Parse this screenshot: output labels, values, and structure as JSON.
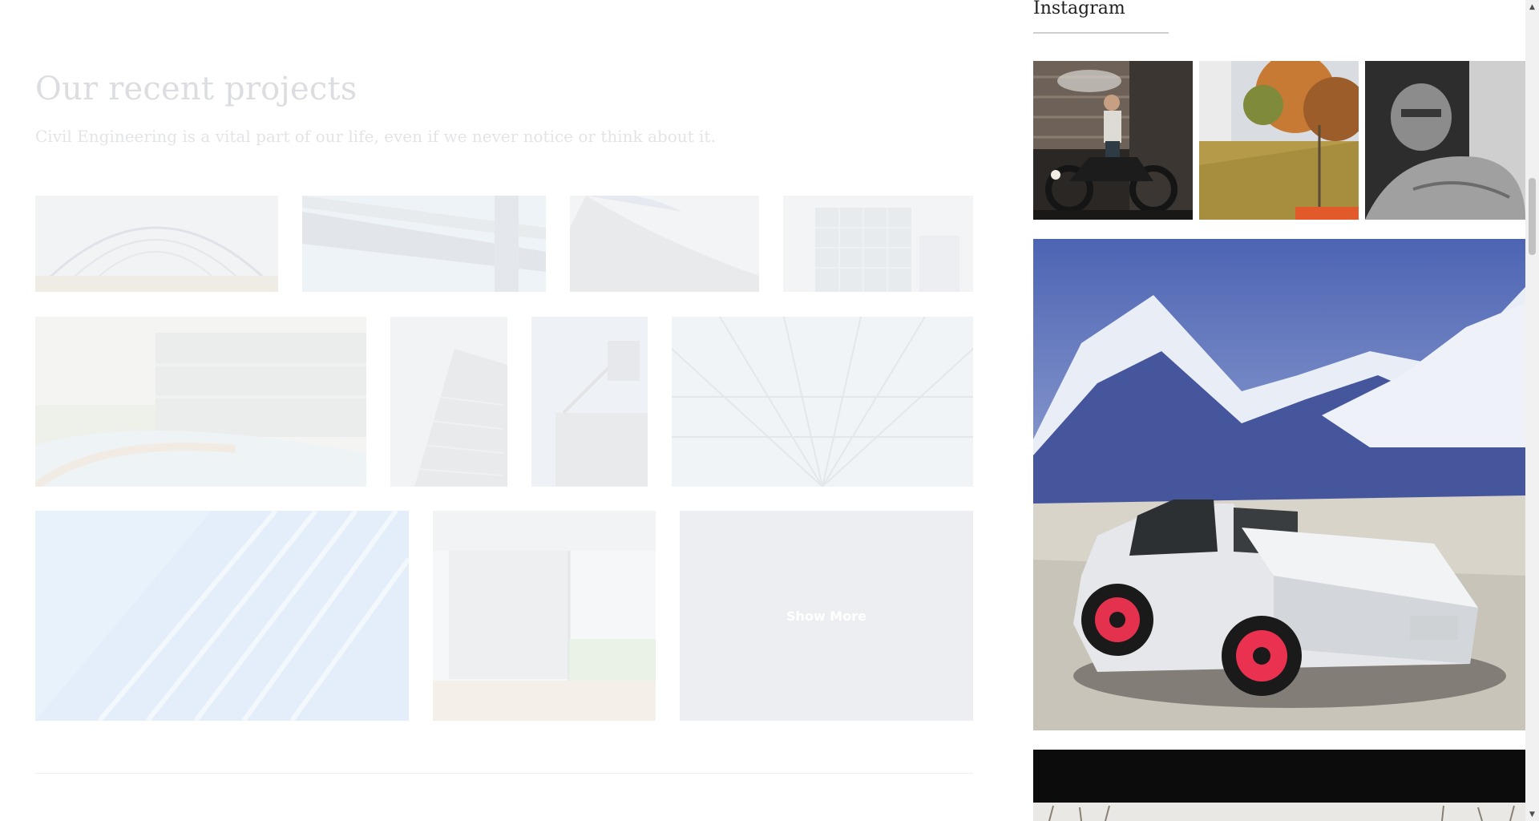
{
  "projects": {
    "title": "Our recent projects",
    "subtitle": "Civil Engineering is a vital part of our life, even if we never notice or think about it.",
    "tiles": [
      "Glass roof arch",
      "Elevated glass walkway",
      "Curved roof edge",
      "Office building facade",
      "Villa with curved pool",
      "Tower facade",
      "Exterior staircase",
      "Glass skylight",
      "Blue glass facade",
      "Interior glass wall"
    ],
    "show_more_label": "Show More"
  },
  "sidebar": {
    "instagram_title": "Instagram",
    "photos": [
      "Man with motorcycle in garage",
      "Autumn backyard",
      "Black and white selfie",
      "White pickup truck in snowy mountains",
      "Snowy trees"
    ]
  },
  "scrollbar": {
    "up_icon": "▲",
    "down_icon": "▼"
  }
}
